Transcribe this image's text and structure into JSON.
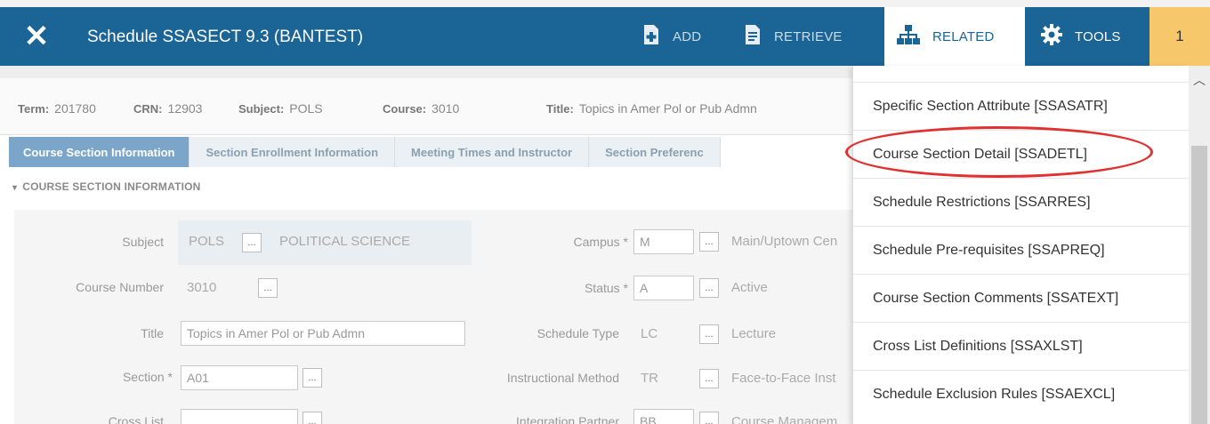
{
  "header": {
    "close_label": "✕",
    "title": "Schedule SSASECT 9.3 (BANTEST)",
    "add_label": "ADD",
    "retrieve_label": "RETRIEVE",
    "related_label": "RELATED",
    "tools_label": "TOOLS",
    "notification_count": "1"
  },
  "keyblock": {
    "term_label": "Term:",
    "term_value": "201780",
    "crn_label": "CRN:",
    "crn_value": "12903",
    "subject_label": "Subject:",
    "subject_value": "POLS",
    "course_label": "Course:",
    "course_value": "3010",
    "title_label": "Title:",
    "title_value": "Topics in Amer Pol or Pub Admn"
  },
  "tabs": [
    {
      "label": "Course Section Information"
    },
    {
      "label": "Section Enrollment Information"
    },
    {
      "label": "Meeting Times and Instructor"
    },
    {
      "label": "Section Preferenc"
    }
  ],
  "section_heading": "COURSE SECTION INFORMATION",
  "form": {
    "subject_label": "Subject",
    "subject_code": "POLS",
    "subject_desc": "POLITICAL SCIENCE",
    "course_number_label": "Course Number",
    "course_number": "3010",
    "title_label": "Title",
    "title_value": "Topics in Amer Pol or Pub Admn",
    "section_label": "Section *",
    "section_value": "A01",
    "cross_list_label": "Cross List",
    "campus_label": "Campus *",
    "campus_value": "M",
    "campus_desc": "Main/Uptown Cen",
    "status_label": "Status *",
    "status_value": "A",
    "status_desc": "Active",
    "schedule_type_label": "Schedule Type",
    "schedule_type_value": "LC",
    "schedule_type_desc": "Lecture",
    "instr_method_label": "Instructional Method",
    "instr_method_value": "TR",
    "instr_method_desc": "Face-to-Face Inst",
    "integration_label": "Integration Partner",
    "integration_value": "BB",
    "integration_desc": "Course Managem",
    "dots": "..."
  },
  "related_menu": {
    "items": [
      {
        "label": "Specific Section Attribute [SSASATR]"
      },
      {
        "label": "Course Section Detail [SSADETL]"
      },
      {
        "label": "Schedule Restrictions [SSARRES]"
      },
      {
        "label": "Schedule Pre-requisites [SSAPREQ]"
      },
      {
        "label": "Course Section Comments [SSATEXT]"
      },
      {
        "label": "Cross List Definitions [SSAXLST]"
      },
      {
        "label": "Schedule Exclusion Rules [SSAEXCL]"
      }
    ],
    "highlighted_index": 1,
    "highlight_color": "#e03030"
  },
  "colors": {
    "header_bg": "#1a6496",
    "active_tab": "#7ba6c9",
    "notification_bg": "#f6c86b"
  }
}
